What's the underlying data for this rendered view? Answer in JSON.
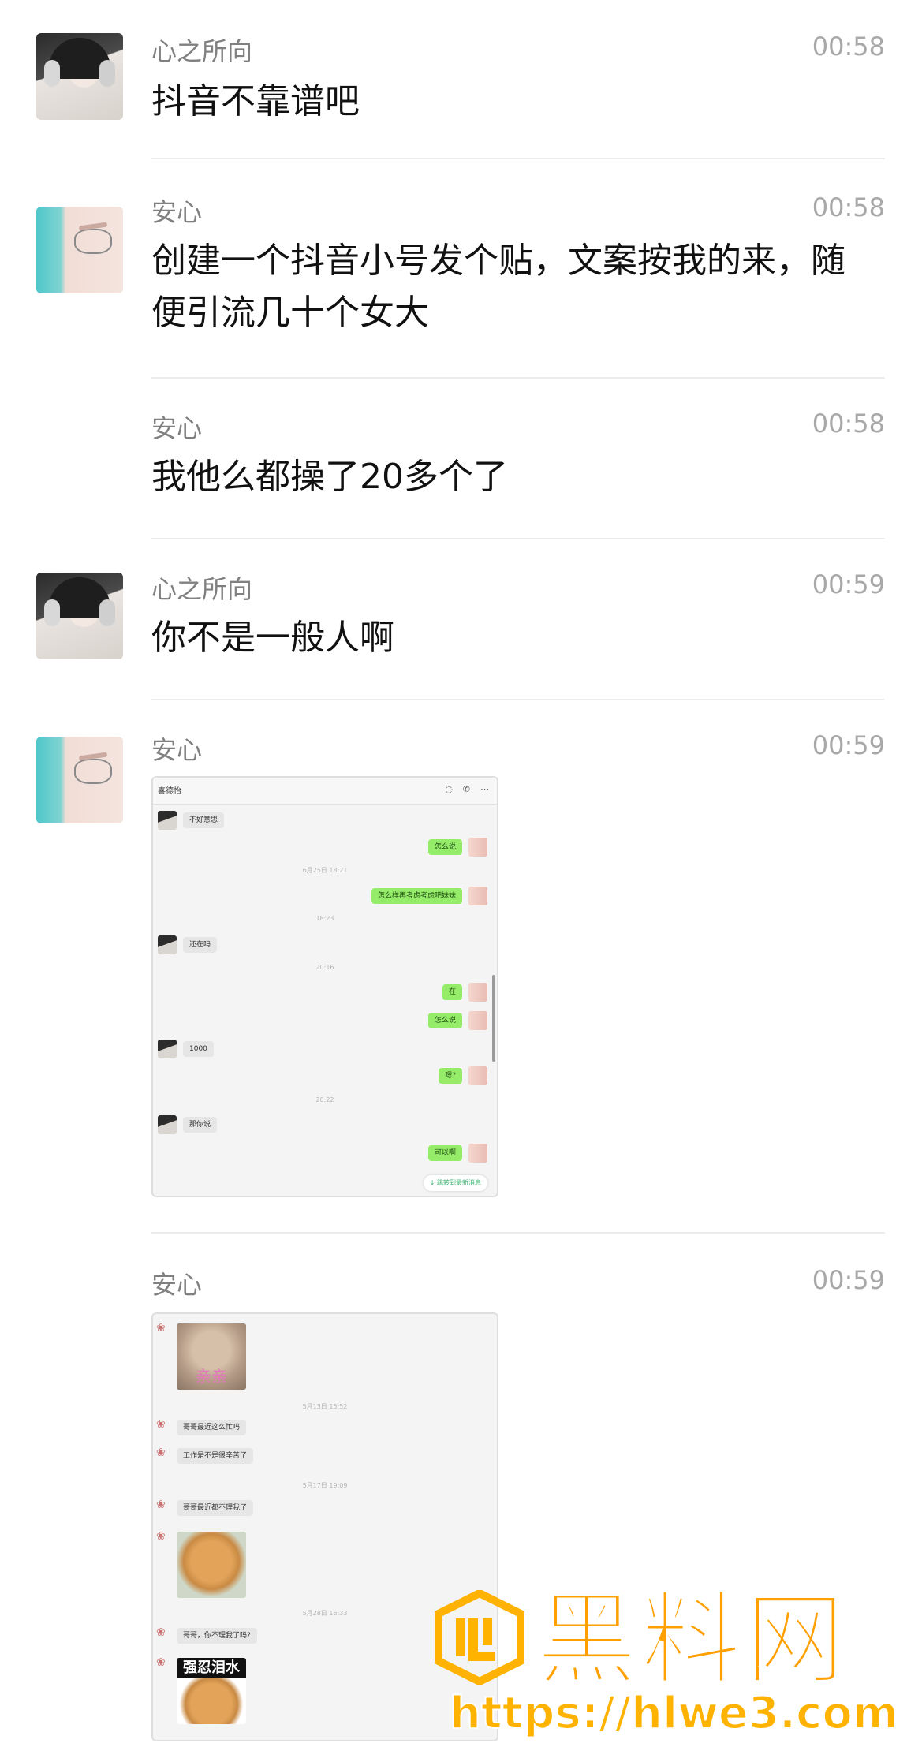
{
  "messages": [
    {
      "sender": "心之所向",
      "time": "00:58",
      "text": "抖音不靠谱吧"
    },
    {
      "sender": "安心",
      "time": "00:58",
      "text": "创建一个抖音小号发个贴，文案按我的来，随便引流几十个女大"
    },
    {
      "sender": "安心",
      "time": "00:58",
      "text": "我他么都操了20多个了"
    },
    {
      "sender": "心之所向",
      "time": "00:59",
      "text": "你不是一般人啊"
    },
    {
      "sender": "安心",
      "time": "00:59"
    },
    {
      "sender": "安心",
      "time": "00:59"
    }
  ],
  "screenshot1": {
    "title": "喜德怡",
    "rows": [
      {
        "side": "left",
        "text": "不好意思"
      },
      {
        "side": "right",
        "text": "怎么说"
      },
      {
        "timestamp": "6月25日 18:21"
      },
      {
        "side": "right",
        "text": "怎么样再考虑考虑吧妹妹"
      },
      {
        "timestamp": "18:23"
      },
      {
        "side": "left",
        "text": "还在吗"
      },
      {
        "timestamp": "20:16"
      },
      {
        "side": "right",
        "text": "在"
      },
      {
        "side": "right",
        "text": "怎么说"
      },
      {
        "side": "left",
        "text": "1000"
      },
      {
        "side": "right",
        "text": "嗯?"
      },
      {
        "timestamp": "20:22"
      },
      {
        "side": "left",
        "text": "那你说"
      },
      {
        "side": "right",
        "text": "可以啊"
      }
    ],
    "new_message": "↓ 跳转到最新消息"
  },
  "screenshot2": {
    "sticker_kiss_text": "亲亲",
    "rows": [
      {
        "timestamp": "5月13日 15:52"
      },
      {
        "text": "哥哥最近这么忙吗"
      },
      {
        "text": "工作是不是很辛苦了"
      },
      {
        "timestamp": "5月17日 19:09"
      },
      {
        "text": "哥哥最近都不理我了"
      },
      {
        "timestamp": "5月28日 16:33"
      },
      {
        "text": "哥哥，你不理我了吗?"
      }
    ],
    "sticker_tears_text": "强忍泪水"
  },
  "watermark": {
    "title": "黑料网",
    "url": "https://hlwe3.com"
  },
  "colors": {
    "accent_green": "#95ec69",
    "watermark_orange": "#ff9f00"
  }
}
